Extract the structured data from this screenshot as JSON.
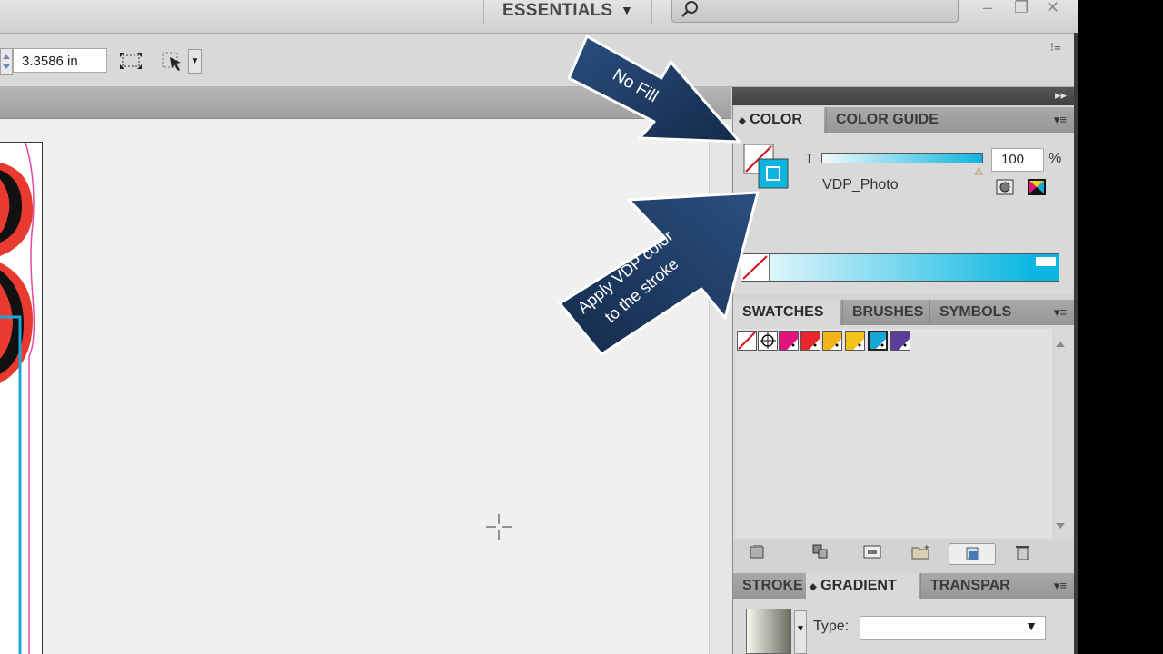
{
  "topbar": {
    "workspace_label": "ESSENTIALS",
    "workspace_arrow": "▼",
    "search_placeholder": "",
    "minimize": "–",
    "restore": "❐",
    "close": "✕"
  },
  "control_bar": {
    "width_value": "3.3586 in",
    "dropdown_arrow": "▼",
    "panel_menu": "⁝≡"
  },
  "dock": {
    "collapse_label": "▸▸"
  },
  "color_panel": {
    "tabs": [
      "COLOR",
      "COLOR GUIDE"
    ],
    "active_tab_prefix": "◆",
    "tint_label": "T",
    "tint_value": "100",
    "tint_unit": "%",
    "swatch_name": "VDP_Photo",
    "menu": "▾≡"
  },
  "swatches_panel": {
    "tabs": [
      "SWATCHES",
      "BRUSHES",
      "SYMBOLS"
    ],
    "menu": "▾≡",
    "swatch_colors": [
      "none",
      "registration",
      "#e0147c",
      "#e8262c",
      "#f3b31a",
      "#f4c21c",
      "#18a8d8",
      "#5b3e9a"
    ]
  },
  "gradient_panel": {
    "tabs": [
      "STROKE",
      "GRADIENT",
      "TRANSPAR"
    ],
    "active_tab_prefix": "◆",
    "type_label": "Type:",
    "type_value": "",
    "menu": "▾≡",
    "select_arrow": "▼"
  },
  "annotations": {
    "callout_1": "No Fill",
    "callout_2_line1": "Apply VDP color",
    "callout_2_line2": "to the stroke"
  },
  "colors": {
    "vdp_cyan": "#0db4e0",
    "callout_navy": "#1d3a63"
  }
}
